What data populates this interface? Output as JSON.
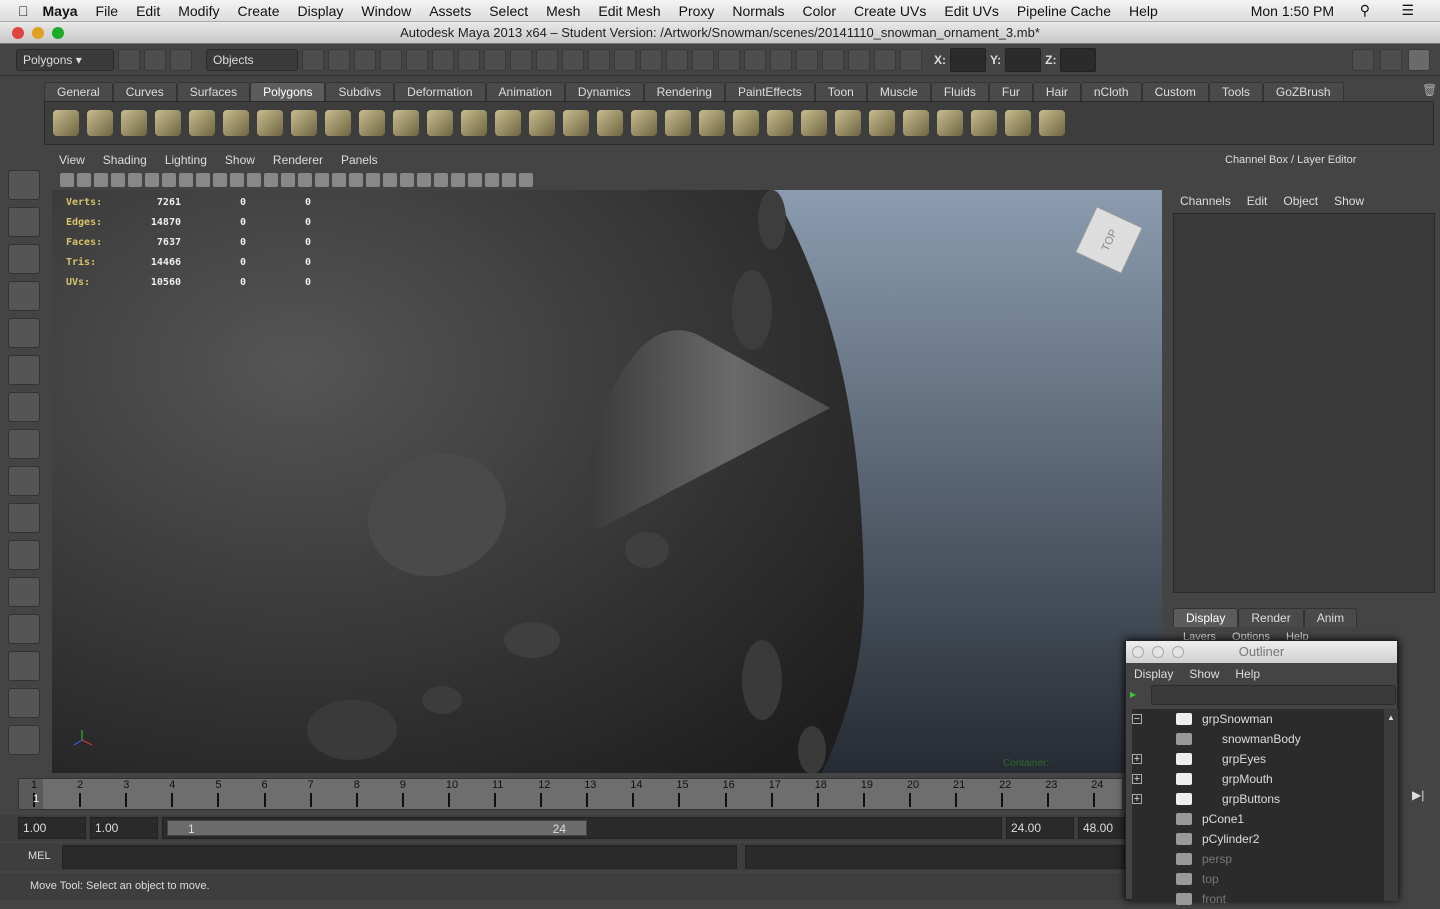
{
  "mac_menu": {
    "app": "Maya",
    "items": [
      "File",
      "Edit",
      "Modify",
      "Create",
      "Display",
      "Window",
      "Assets",
      "Select",
      "Mesh",
      "Edit Mesh",
      "Proxy",
      "Normals",
      "Color",
      "Create UVs",
      "Edit UVs",
      "Pipeline Cache",
      "Help"
    ],
    "clock": "Mon 1:50 PM"
  },
  "window_title": "Autodesk Maya 2013 x64 – Student Version: /Artwork/Snowman/scenes/20141110_snowman_ornament_3.mb*",
  "status_line": {
    "menu_set": "Polygons",
    "selection_mode": "Objects",
    "x_label": "X:",
    "y_label": "Y:",
    "z_label": "Z:"
  },
  "shelf": {
    "tabs": [
      "General",
      "Curves",
      "Surfaces",
      "Polygons",
      "Subdivs",
      "Deformation",
      "Animation",
      "Dynamics",
      "Rendering",
      "PaintEffects",
      "Toon",
      "Muscle",
      "Fluids",
      "Fur",
      "Hair",
      "nCloth",
      "Custom",
      "Tools",
      "GoZBrush"
    ],
    "active": "Polygons"
  },
  "panel": {
    "menus": [
      "View",
      "Shading",
      "Lighting",
      "Show",
      "Renderer",
      "Panels"
    ],
    "view_cube": "TOP",
    "container_label": "Container:"
  },
  "hud": [
    {
      "label": "Verts:",
      "v": "7261",
      "a": "0",
      "b": "0"
    },
    {
      "label": "Edges:",
      "v": "14870",
      "a": "0",
      "b": "0"
    },
    {
      "label": "Faces:",
      "v": "7637",
      "a": "0",
      "b": "0"
    },
    {
      "label": "Tris:",
      "v": "14466",
      "a": "0",
      "b": "0"
    },
    {
      "label": "UVs:",
      "v": "10560",
      "a": "0",
      "b": "0"
    }
  ],
  "channel_box": {
    "title": "Channel Box / Layer Editor",
    "menus": [
      "Channels",
      "Edit",
      "Object",
      "Show"
    ],
    "layer_tabs": [
      "Display",
      "Render",
      "Anim"
    ],
    "active_layer_tab": "Display",
    "layer_menus": [
      "Layers",
      "Options",
      "Help"
    ]
  },
  "timeline": {
    "ticks": [
      "1",
      "2",
      "3",
      "4",
      "5",
      "6",
      "7",
      "8",
      "9",
      "10",
      "11",
      "12",
      "13",
      "14",
      "15",
      "16",
      "17",
      "18",
      "19",
      "20",
      "21",
      "22",
      "23",
      "24"
    ],
    "current_frame": "1"
  },
  "range": {
    "start": "1.00",
    "playback_start": "1.00",
    "slider_start": "1",
    "slider_end": "24",
    "playback_end": "24.00",
    "end": "48.00"
  },
  "command_line": {
    "label": "MEL"
  },
  "help_line": "Move Tool: Select an object to move.",
  "outliner": {
    "title": "Outliner",
    "menus": [
      "Display",
      "Show",
      "Help"
    ],
    "items": [
      {
        "name": "grpSnowman",
        "type": "group",
        "depth": 0,
        "expand": "minus"
      },
      {
        "name": "snowmanBody",
        "type": "mesh",
        "depth": 1,
        "expand": ""
      },
      {
        "name": "grpEyes",
        "type": "group",
        "depth": 1,
        "expand": "plus"
      },
      {
        "name": "grpMouth",
        "type": "group",
        "depth": 1,
        "expand": "plus"
      },
      {
        "name": "grpButtons",
        "type": "group",
        "depth": 1,
        "expand": "plus"
      },
      {
        "name": "pCone1",
        "type": "mesh",
        "depth": 0,
        "expand": ""
      },
      {
        "name": "pCylinder2",
        "type": "mesh",
        "depth": 0,
        "expand": ""
      },
      {
        "name": "persp",
        "type": "camera",
        "depth": 0,
        "expand": ""
      },
      {
        "name": "top",
        "type": "camera",
        "depth": 0,
        "expand": ""
      },
      {
        "name": "front",
        "type": "camera",
        "depth": 0,
        "expand": ""
      }
    ]
  }
}
